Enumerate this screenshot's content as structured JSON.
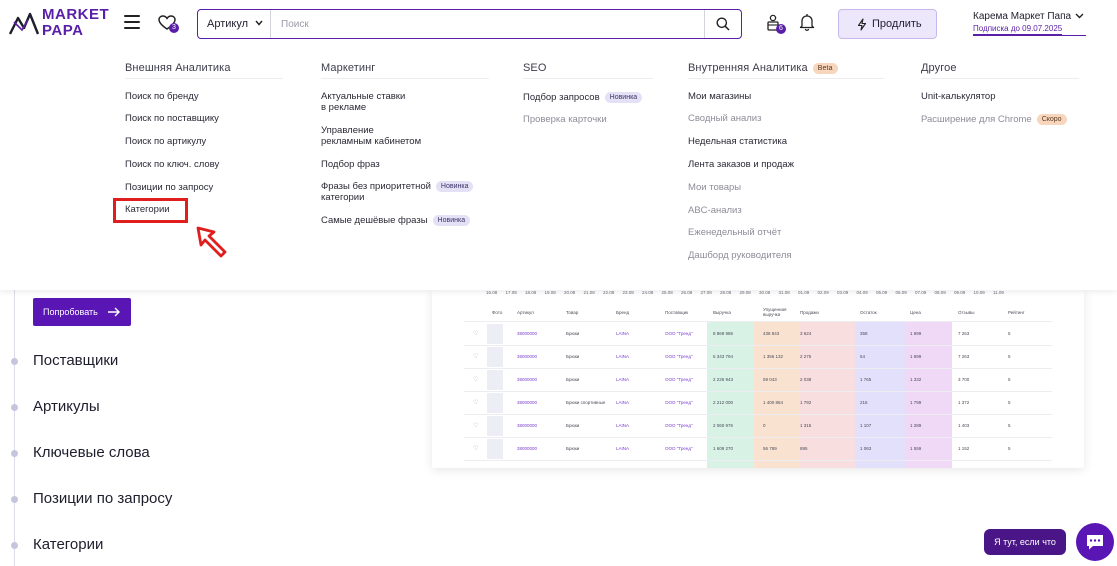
{
  "header": {
    "logo_line1": "MARKET",
    "logo_line2": "PAPA",
    "favorites_count": "3",
    "search": {
      "type_value": "Артикул",
      "placeholder": "Поиск"
    },
    "orders_count": "6",
    "extend_label": "Продлить",
    "user_name": "Карема Маркет Папа",
    "subscription": "Подписка до 09.07.2025"
  },
  "menu": {
    "columns": [
      {
        "title": "Внешняя Аналитика",
        "items": [
          {
            "label": "Поиск по бренду"
          },
          {
            "label": "Поиск по поставщику"
          },
          {
            "label": "Поиск по артикулу"
          },
          {
            "label": "Поиск по ключ. слову"
          },
          {
            "label": "Позиции по запросу"
          },
          {
            "label": "Категории"
          }
        ]
      },
      {
        "title": "Маркетинг",
        "items": [
          {
            "line1": "Актуальные ставки",
            "line2": "в рекламе"
          },
          {
            "line1": "Управление",
            "line2": "рекламным кабинетом"
          },
          {
            "line1": "Подбор фраз"
          },
          {
            "line1": "Фразы без приоритетной",
            "line2": "категории",
            "tag": "Новинка"
          },
          {
            "line1": "Самые дешёвые фразы",
            "tag": "Новинка"
          }
        ]
      },
      {
        "title": "SEO",
        "items": [
          {
            "label": "Подбор запросов",
            "tag": "Новинка"
          },
          {
            "label": "Проверка карточки"
          }
        ]
      },
      {
        "title": "Внутренняя Аналитика",
        "tag": "Beta",
        "items": [
          {
            "label": "Мои магазины"
          },
          {
            "label": "Сводный анализ"
          },
          {
            "label": "Недельная статистика"
          },
          {
            "label": "Лента заказов и продаж"
          },
          {
            "label": "Мои товары"
          },
          {
            "label": "ABC-анализ"
          },
          {
            "label": "Еженедельный отчёт"
          },
          {
            "label": "Дашборд руководителя"
          }
        ]
      },
      {
        "title": "Другое",
        "items": [
          {
            "label": "Unit-калькулятор"
          },
          {
            "label": "Расширение для Chrome",
            "tag": "Скоро"
          }
        ]
      }
    ]
  },
  "sidebar": {
    "try_label": "Попробовать",
    "items": [
      "Поставщики",
      "Артикулы",
      "Ключевые слова",
      "Позиции по запросу",
      "Категории"
    ]
  },
  "preview": {
    "dates": [
      "16.08",
      "17.08",
      "18.08",
      "19.08",
      "20.08",
      "21.08",
      "22.08",
      "23.08",
      "24.08",
      "25.08",
      "26.08",
      "27.08",
      "28.08",
      "29.08",
      "30.08",
      "31.08",
      "01.09",
      "02.09",
      "03.09",
      "04.09",
      "05.09",
      "06.09",
      "07.09",
      "08.09",
      "09.09",
      "10.09",
      "11.09"
    ],
    "columns": [
      "Фото",
      "Артикул",
      "Товар",
      "Бренд",
      "Поставщик",
      "Выручка",
      "Упущенная выручка",
      "Продажи",
      "Остаток",
      "Цена",
      "Отзывы",
      "Рейтинг"
    ],
    "rows": [
      {
        "sku": "38000000",
        "name": "Брюки",
        "brand": "LAINA",
        "supplier": "ООО \"Тренд\"",
        "revenue": "8 869 986",
        "lost": "438 843",
        "sales": "3 624",
        "stock": "358",
        "price": "1 899",
        "reviews": "7 263",
        "rating": "5"
      },
      {
        "sku": "38000000",
        "name": "Брюки",
        "brand": "LAINA",
        "supplier": "ООО \"Тренд\"",
        "revenue": "5 343 794",
        "lost": "1 356 132",
        "sales": "2 275",
        "stock": "54",
        "price": "1 899",
        "reviews": "7 263",
        "rating": "5"
      },
      {
        "sku": "38000000",
        "name": "Брюки",
        "brand": "LAINA",
        "supplier": "ООО \"Тренд\"",
        "revenue": "2 226 943",
        "lost": "59 043",
        "sales": "2 038",
        "stock": "1 765",
        "price": "1 332",
        "reviews": "3 700",
        "rating": "5"
      },
      {
        "sku": "38000000",
        "name": "Брюки спортивные",
        "brand": "LAINA",
        "supplier": "ООО \"Тренд\"",
        "revenue": "2 212 000",
        "lost": "1 400 864",
        "sales": "1 792",
        "stock": "216",
        "price": "1 799",
        "reviews": "1 372",
        "rating": "5"
      },
      {
        "sku": "38000000",
        "name": "Брюки",
        "brand": "LAINA",
        "supplier": "ООО \"Тренд\"",
        "revenue": "2 060 976",
        "lost": "0",
        "sales": "1 315",
        "stock": "1 107",
        "price": "1 289",
        "reviews": "1 403",
        "rating": "5"
      },
      {
        "sku": "38000000",
        "name": "Брюки",
        "brand": "LAINA",
        "supplier": "ООО \"Тренд\"",
        "revenue": "1 609 270",
        "lost": "56 789",
        "sales": "895",
        "stock": "1 063",
        "price": "1 559",
        "reviews": "1 152",
        "rating": "5"
      }
    ]
  },
  "help_label": "Я тут, если что",
  "colors": {
    "brand": "#5a16b5",
    "highlight": "#e01e1e",
    "revenue_band": "#d8f2e6",
    "lost_band": "#f9e3d0",
    "sales_band": "#f8dede",
    "stock_band": "#e2e0fa",
    "price_band": "#f0d9f7"
  }
}
